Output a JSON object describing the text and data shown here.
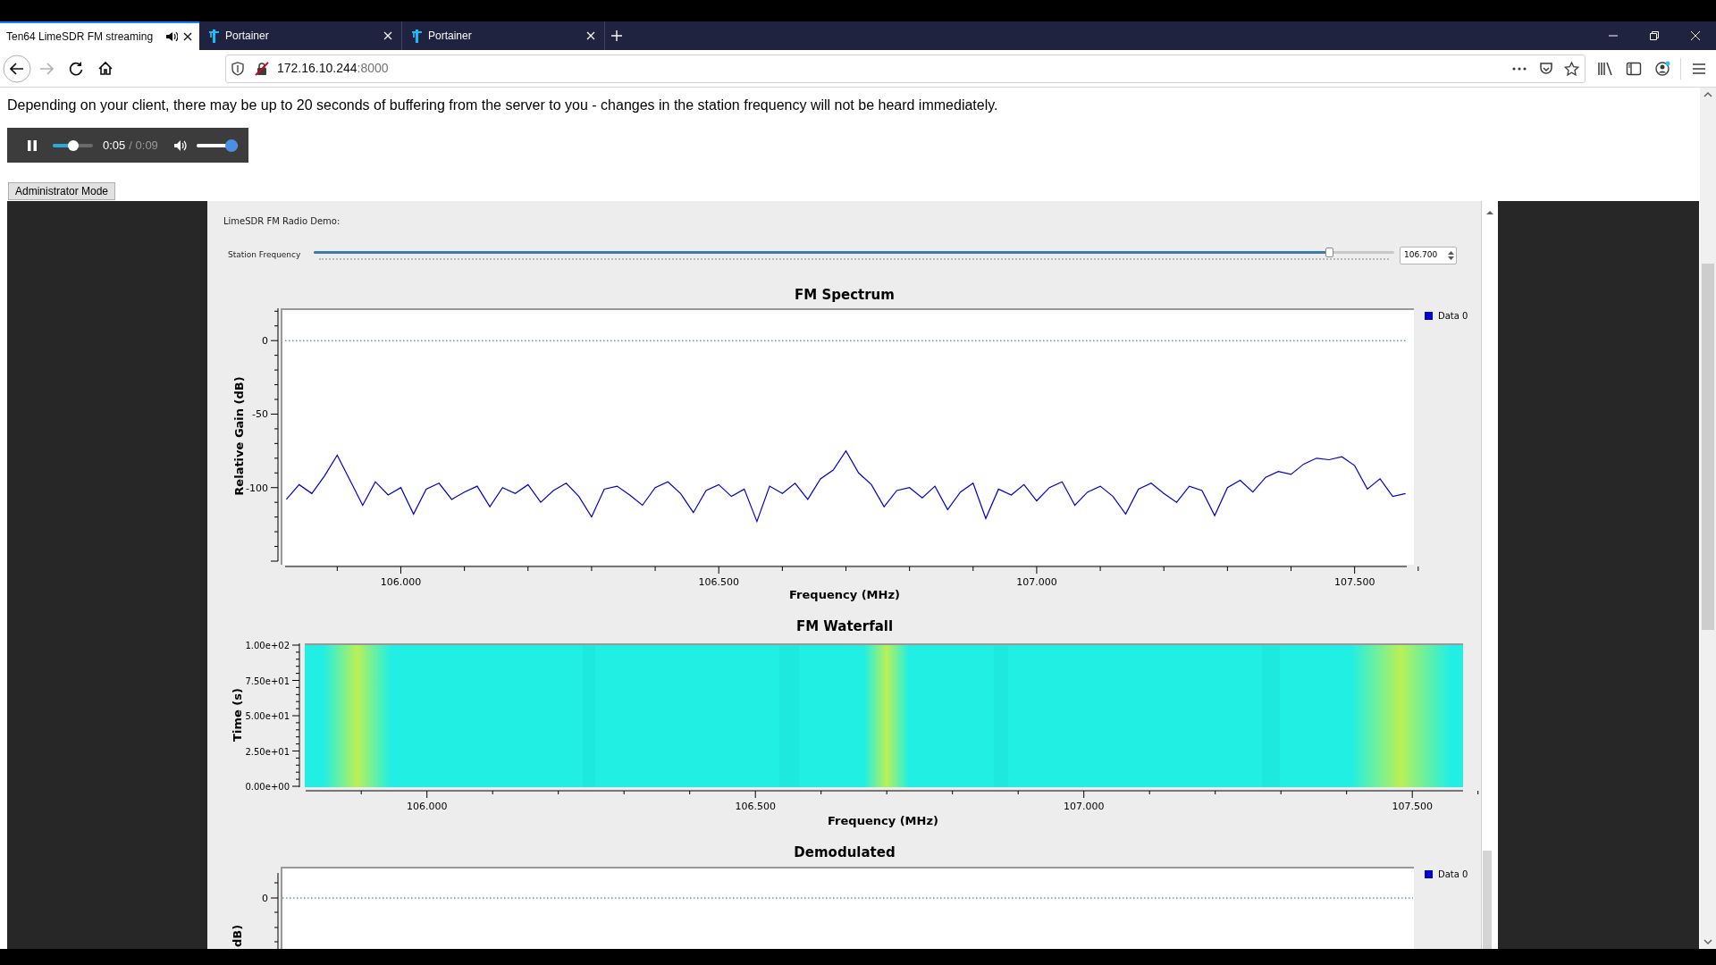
{
  "browser": {
    "tabs": [
      {
        "label": "Ten64 LimeSDR FM streaming",
        "selected": true,
        "favicon": false,
        "playing": true
      },
      {
        "label": "Portainer",
        "selected": false,
        "favicon": true,
        "playing": false
      },
      {
        "label": "Portainer",
        "selected": false,
        "favicon": true,
        "playing": false
      }
    ],
    "nav_buttons": [
      {
        "kind": "back",
        "disabled": false
      },
      {
        "kind": "forward",
        "disabled": true
      },
      {
        "kind": "reload",
        "disabled": false
      },
      {
        "kind": "home",
        "disabled": false
      }
    ],
    "address": {
      "host": "172.16.10.244",
      "port": ":8000"
    }
  },
  "page": {
    "notice": "Depending on your client, there may be up to 20 seconds of buffering from the server to you - changes in the station frequency will not be heard immediately.",
    "player": {
      "playing": true,
      "progress": {
        "level": 0.5
      },
      "current": "0:05",
      "duration": "/ 0:09",
      "volume": {
        "level": 1
      }
    },
    "admin_button": "Administrator Mode",
    "app": {
      "heading": "LimeSDR FM Radio Demo:",
      "frequency": {
        "label": "Station Frequency",
        "level": 0.94,
        "value": "106.700"
      },
      "spectrum": {
        "chart_data": {
          "type": "line",
          "title": "FM Spectrum",
          "xlabel": "Frequency (MHz)",
          "ylabel": "Relative Gain (dB)",
          "x": [
            105.82,
            105.84,
            105.86,
            105.88,
            105.9,
            105.92,
            105.94,
            105.96,
            105.98,
            106,
            106.02,
            106.04,
            106.06,
            106.08,
            106.1,
            106.12,
            106.14,
            106.16,
            106.18,
            106.2,
            106.22,
            106.24,
            106.26,
            106.28,
            106.3,
            106.32,
            106.34,
            106.36,
            106.38,
            106.4,
            106.42,
            106.44,
            106.46,
            106.48,
            106.5,
            106.52,
            106.54,
            106.56,
            106.58,
            106.6,
            106.62,
            106.64,
            106.66,
            106.68,
            106.7,
            106.72,
            106.74,
            106.76,
            106.78,
            106.8,
            106.82,
            106.84,
            106.86,
            106.88,
            106.9,
            106.92,
            106.94,
            106.96,
            106.98,
            107,
            107.02,
            107.04,
            107.06,
            107.08,
            107.1,
            107.12,
            107.14,
            107.16,
            107.18,
            107.2,
            107.22,
            107.24,
            107.26,
            107.28,
            107.3,
            107.32,
            107.34,
            107.36,
            107.38,
            107.4,
            107.42,
            107.44,
            107.46,
            107.48,
            107.5,
            107.52,
            107.54,
            107.56,
            107.58
          ],
          "series": [
            {
              "name": "Data 0",
              "color": "#0000cc",
              "values": [
                -108,
                -98,
                -104,
                -92,
                -78,
                -95,
                -112,
                -96,
                -105,
                -100,
                -118,
                -101,
                -97,
                -108,
                -103,
                -99,
                -113,
                -100,
                -104,
                -98,
                -110,
                -102,
                -97,
                -106,
                -120,
                -101,
                -99,
                -105,
                -112,
                -100,
                -96,
                -104,
                -117,
                -102,
                -98,
                -106,
                -101,
                -123,
                -99,
                -104,
                -97,
                -108,
                -94,
                -88,
                -75,
                -90,
                -98,
                -113,
                -102,
                -100,
                -107,
                -99,
                -115,
                -103,
                -97,
                -121,
                -101,
                -105,
                -98,
                -109,
                -100,
                -96,
                -112,
                -103,
                -99,
                -106,
                -118,
                -101,
                -97,
                -104,
                -110,
                -99,
                -102,
                -119,
                -100,
                -95,
                -103,
                -93,
                -89,
                -91,
                -84,
                -80,
                -81,
                -79,
                -85,
                -101,
                -94,
                -106,
                -104
              ]
            }
          ],
          "xlim": [
            105.818,
            107.582
          ],
          "ylim": [
            -150,
            22
          ],
          "ref_lines": [
            {
              "axis": "y",
              "value": 0,
              "color": "#007a7a"
            }
          ],
          "xticks": [
            {
              "value": 106,
              "label": "106.000"
            },
            {
              "value": 106.5,
              "label": "106.500"
            },
            {
              "value": 107,
              "label": "107.000"
            },
            {
              "value": 107.5,
              "label": "107.500"
            }
          ],
          "yticks": [
            0,
            -50,
            -100
          ]
        }
      },
      "waterfall": {
        "title": "FM Waterfall",
        "ylabel": "Time (s)",
        "yticks": [
          "1.00e+02",
          "7.50e+01",
          "5.00e+01",
          "2.50e+01",
          "0.00e+00"
        ],
        "xticks": [
          "106.000",
          "106.500",
          "107.000",
          "107.500"
        ],
        "xlabel": "Frequency (MHz)"
      },
      "demodulated": {
        "title": "Demodulated",
        "ytick": "0",
        "ylabel": "dB)",
        "legend": "Data 0"
      }
    }
  }
}
